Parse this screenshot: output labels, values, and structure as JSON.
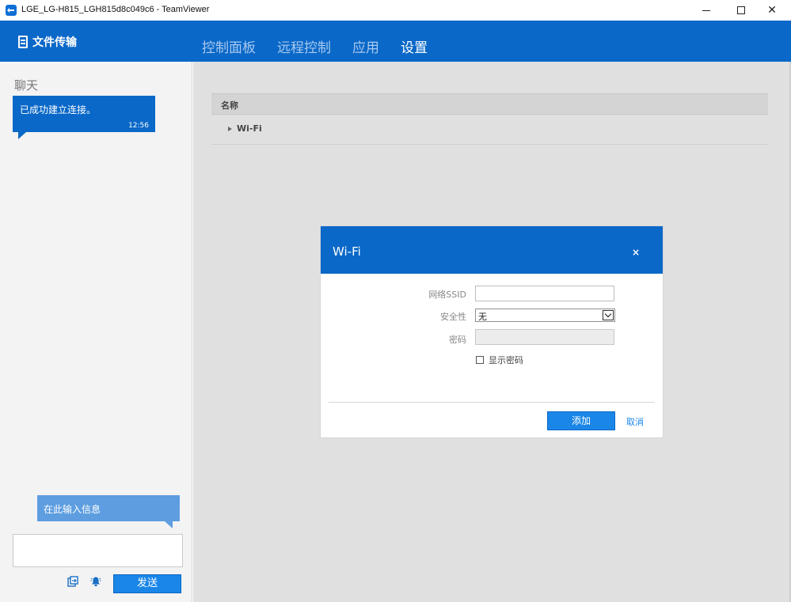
{
  "window": {
    "title": "LGE_LG-H815_LGH815d8c049c6 - TeamViewer"
  },
  "header": {
    "file_transfer_label": "文件传输",
    "tabs": [
      {
        "label": "控制面板",
        "active": false
      },
      {
        "label": "远程控制",
        "active": false
      },
      {
        "label": "应用",
        "active": false
      },
      {
        "label": "设置",
        "active": true
      }
    ]
  },
  "chat": {
    "title": "聊天",
    "message": {
      "text": "已成功建立连接。",
      "time": "12:56"
    },
    "input_hint": "在此输入信息",
    "send_label": "发送"
  },
  "settings_table": {
    "column_name": "名称",
    "rows": [
      {
        "label": "Wi-Fi"
      }
    ]
  },
  "wifi_dialog": {
    "title": "Wi-Fi",
    "close_glyph": "×",
    "ssid_label": "网络SSID",
    "ssid_value": "",
    "security_label": "安全性",
    "security_value": "无",
    "password_label": "密码",
    "show_password_label": "显示密码",
    "add_label": "添加",
    "cancel_label": "取消"
  },
  "colors": {
    "brand_blue": "#0a68c8",
    "button_blue": "#1a86e8",
    "inactive_tab": "#a9c9ef"
  }
}
